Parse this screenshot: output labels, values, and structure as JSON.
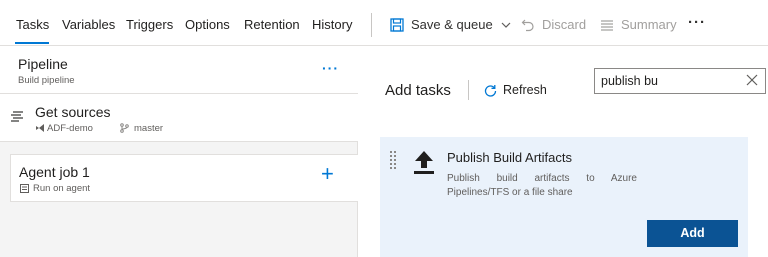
{
  "tabs": [
    {
      "label": "Tasks"
    },
    {
      "label": "Variables"
    },
    {
      "label": "Triggers"
    },
    {
      "label": "Options"
    },
    {
      "label": "Retention"
    },
    {
      "label": "History"
    }
  ],
  "toolbar": {
    "save_queue_label": "Save & queue",
    "discard_label": "Discard",
    "summary_label": "Summary",
    "more_label": "···"
  },
  "pipeline": {
    "title": "Pipeline",
    "subtitle": "Build pipeline",
    "more_label": "···"
  },
  "sources": {
    "title": "Get sources",
    "repo": "ADF-demo",
    "branch": "master"
  },
  "agent_job": {
    "title": "Agent job 1",
    "subtitle": "Run on agent",
    "add_label": "+"
  },
  "add_tasks": {
    "heading": "Add tasks",
    "refresh_label": "Refresh",
    "search_value": "publish bu"
  },
  "task": {
    "title": "Publish Build Artifacts",
    "description": "Publish build artifacts to Azure Pipelines/TFS or a file share",
    "add_button_label": "Add"
  },
  "colors": {
    "accent": "#0078d4",
    "add_button": "#0b5394",
    "task_card_bg": "#eaf2fb",
    "left_panel_bg": "#f4f4f4"
  }
}
